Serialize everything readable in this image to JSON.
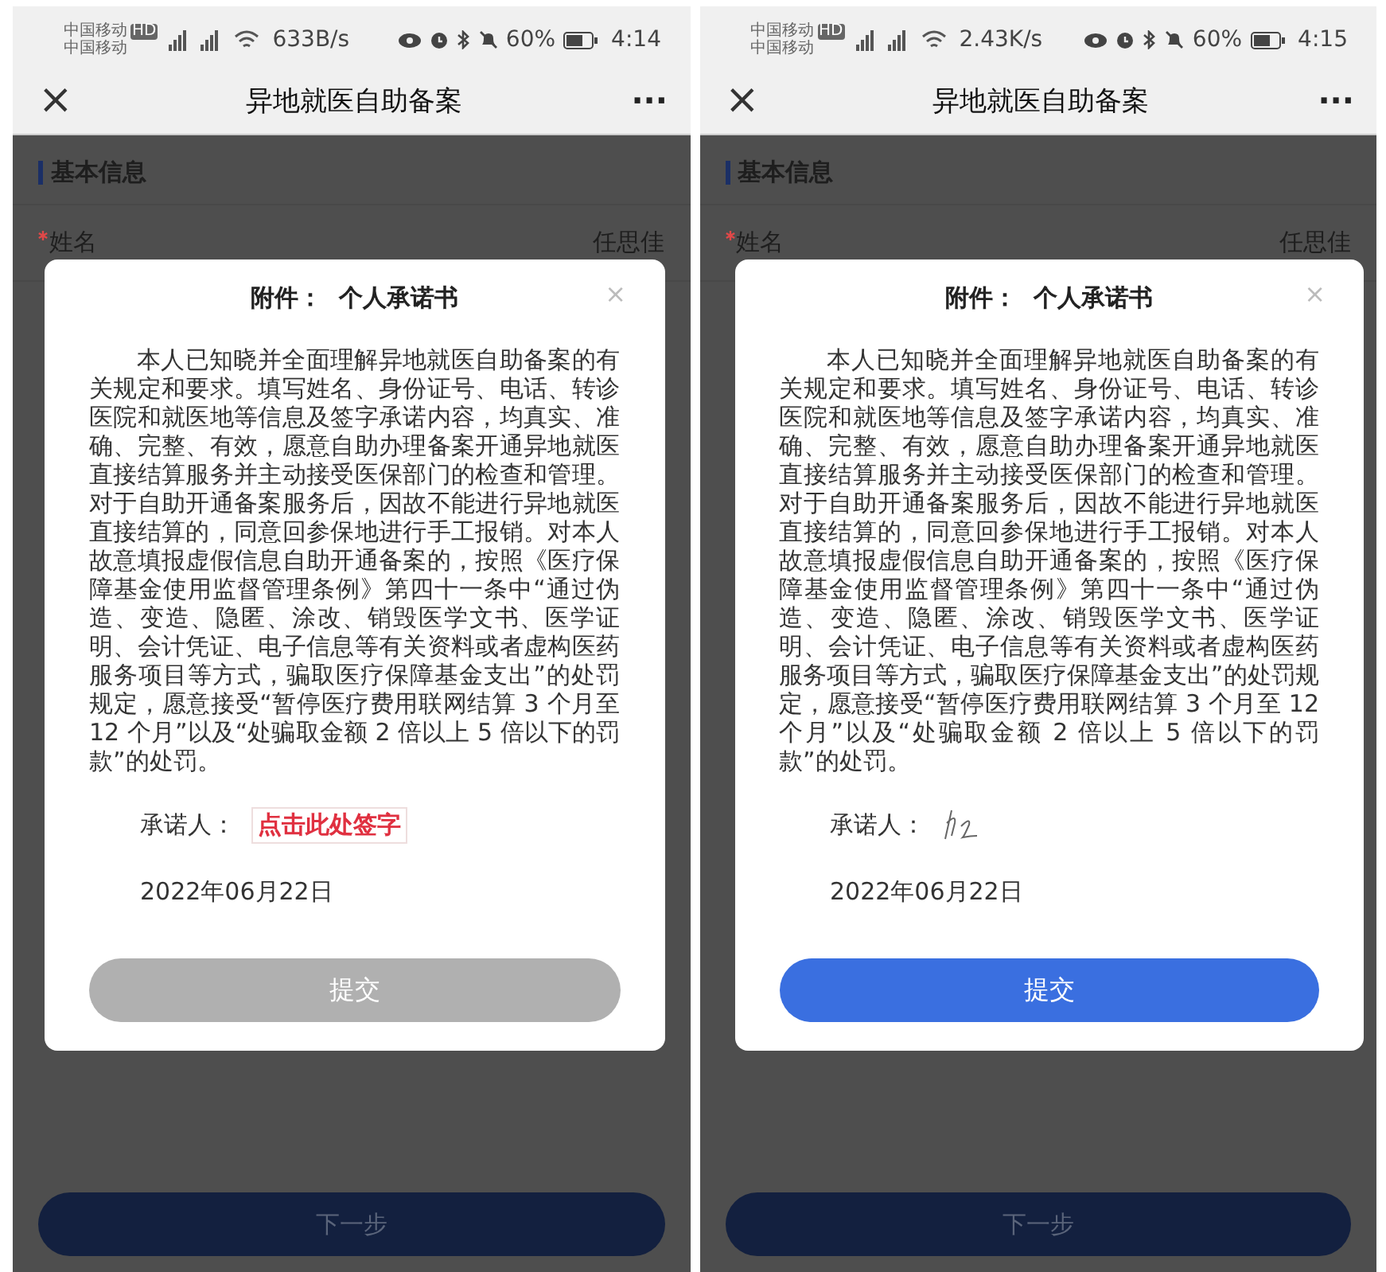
{
  "screens": [
    {
      "status_bar": {
        "carrier_lines": [
          "中国移动",
          "中国移动"
        ],
        "hd": "HD",
        "speed": "633B/s",
        "battery": "60%",
        "time": "4:14"
      },
      "nav": {
        "close": "×",
        "title": "异地就医自助备案",
        "more": "···"
      },
      "section": {
        "title": "基本信息"
      },
      "fields": [
        {
          "label": "姓名",
          "value": "任思佳",
          "required": true
        }
      ],
      "modal": {
        "title": "附件：  个人承诺书",
        "close": "×",
        "body": "本人已知晓并全面理解异地就医自助备案的有关规定和要求。填写姓名、身份证号、电话、转诊医院和就医地等信息及签字承诺内容，均真实、准确、完整、有效，愿意自助办理备案开通异地就医直接结算服务并主动接受医保部门的检查和管理。对于自助开通备案服务后，因故不能进行异地就医直接结算的，同意回参保地进行手工报销。对本人故意填报虚假信息自助开通备案的，按照《医疗保障基金使用监督管理条例》第四十一条中“通过伪造、变造、隐匿、涂改、销毁医学文书、医学证明、会计凭证、电子信息等有关资料或者虚构医药服务项目等方式，骗取医疗保障基金支出”的处罚规定，愿意接受“暂停医疗费用联网结算 3 个月至 12 个月”以及“处骗取金额 2 倍以上 5 倍以下的罚款”的处罚。",
        "signer_label": "承诺人：",
        "signature": {
          "kind": "link",
          "label": "点击此处签字"
        },
        "date": "2022年06月22日",
        "submit": {
          "label": "提交",
          "disabled": true
        }
      },
      "next_button": {
        "label": "下一步"
      }
    },
    {
      "status_bar": {
        "carrier_lines": [
          "中国移动",
          "中国移动"
        ],
        "hd": "HD",
        "speed": "2.43K/s",
        "battery": "60%",
        "time": "4:15"
      },
      "nav": {
        "close": "×",
        "title": "异地就医自助备案",
        "more": "···"
      },
      "section": {
        "title": "基本信息"
      },
      "fields": [
        {
          "label": "姓名",
          "value": "任思佳",
          "required": true
        }
      ],
      "modal": {
        "title": "附件：  个人承诺书",
        "close": "×",
        "body": "本人已知晓并全面理解异地就医自助备案的有关规定和要求。填写姓名、身份证号、电话、转诊医院和就医地等信息及签字承诺内容，均真实、准确、完整、有效，愿意自助办理备案开通异地就医直接结算服务并主动接受医保部门的检查和管理。对于自助开通备案服务后，因故不能进行异地就医直接结算的，同意回参保地进行手工报销。对本人故意填报虚假信息自助开通备案的，按照《医疗保障基金使用监督管理条例》第四十一条中“通过伪造、变造、隐匿、涂改、销毁医学文书、医学证明、会计凭证、电子信息等有关资料或者虚构医药服务项目等方式，骗取医疗保障基金支出”的处罚规定，愿意接受“暂停医疗费用联网结算 3 个月至 12 个月”以及“处骗取金额 2 倍以上 5 倍以下的罚款”的处罚。",
        "signer_label": "承诺人：",
        "signature": {
          "kind": "handwritten"
        },
        "date": "2022年06月22日",
        "submit": {
          "label": "提交",
          "disabled": false
        }
      },
      "next_button": {
        "label": "下一步"
      }
    }
  ]
}
